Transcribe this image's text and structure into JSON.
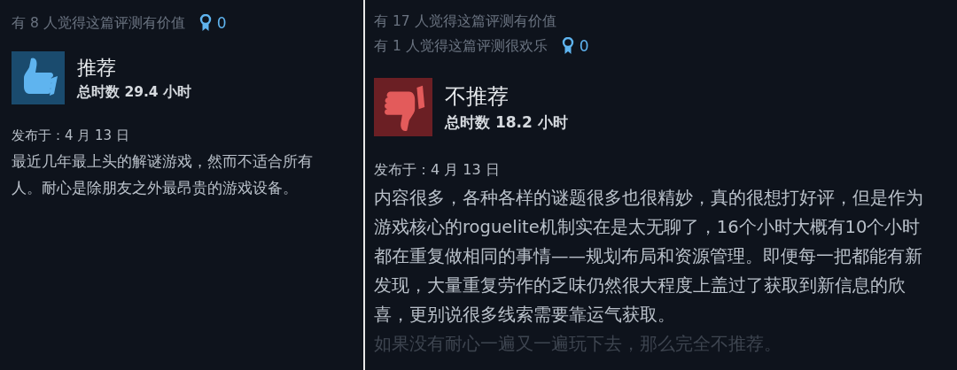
{
  "reviews": [
    {
      "helpful": [
        "有 8 人觉得这篇评测有价值"
      ],
      "award_count": "0",
      "recommended": true,
      "verdict": "推荐",
      "playtime": "总时数 29.4 小时",
      "posted": "发布于：4 月 13 日",
      "body": [
        {
          "text": "最近几年最上头的解谜游戏，然而不适合所有",
          "faded": false
        },
        {
          "text": "人。耐心是除朋友之外最昂贵的游戏设备。",
          "faded": false
        }
      ]
    },
    {
      "helpful": [
        "有 17 人觉得这篇评测有价值",
        "有 1 人觉得这篇评测很欢乐"
      ],
      "award_count": "0",
      "recommended": false,
      "verdict": "不推荐",
      "playtime": "总时数 18.2 小时",
      "posted": "发布于：4 月 13 日",
      "body": [
        {
          "text": "内容很多，各种各样的谜题很多也很精妙，真的很想打好评，但是作为",
          "faded": false
        },
        {
          "text": "游戏核心的roguelite机制实在是太无聊了，16个小时大概有10个小时",
          "faded": false
        },
        {
          "text": "都在重复做相同的事情——规划布局和资源管理。即便每一把都能有新",
          "faded": false
        },
        {
          "text": "发现，大量重复劳作的乏味仍然很大程度上盖过了获取到新信息的欣",
          "faded": false
        },
        {
          "text": "喜，更别说很多线索需要靠运气获取。",
          "faded": false
        },
        {
          "text": "如果没有耐心一遍又一遍玩下去，那么完全不推荐。",
          "faded": true
        }
      ]
    }
  ]
}
